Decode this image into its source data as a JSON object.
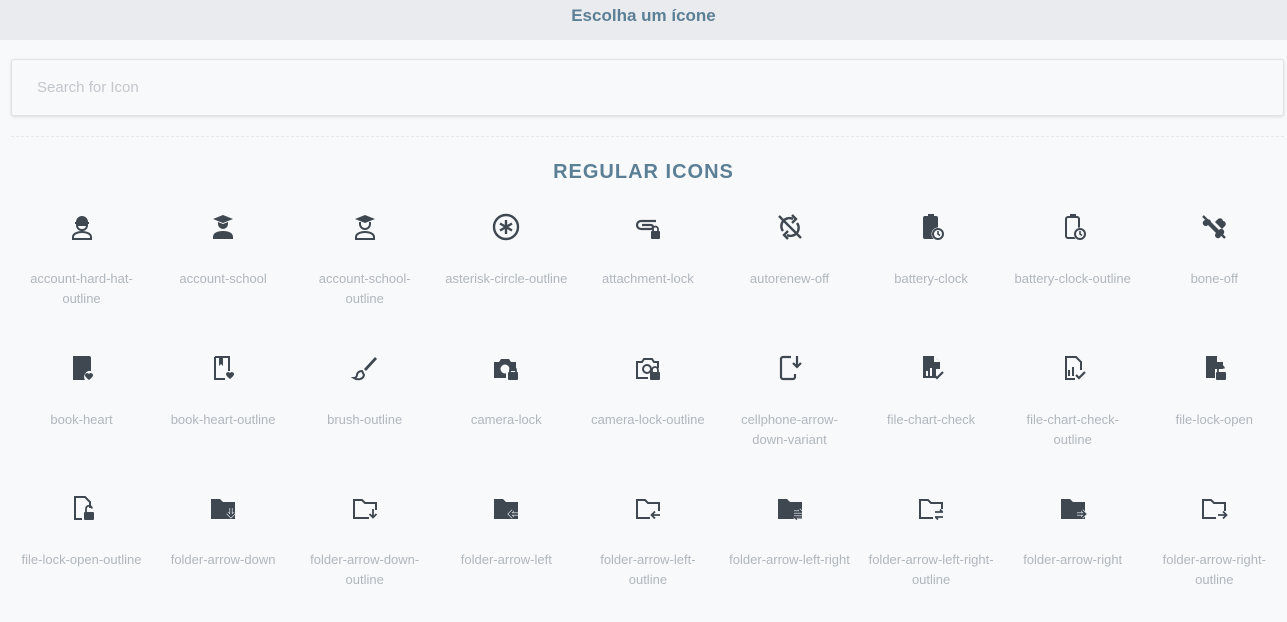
{
  "header": {
    "title": "Escolha um ícone"
  },
  "search": {
    "placeholder": "Search for Icon",
    "value": ""
  },
  "section": {
    "title": "REGULAR ICONS"
  },
  "icons": [
    {
      "name": "account-hard-hat-outline",
      "label": "account-hard-hat-outline"
    },
    {
      "name": "account-school",
      "label": "account-school"
    },
    {
      "name": "account-school-outline",
      "label": "account-school-outline"
    },
    {
      "name": "asterisk-circle-outline",
      "label": "asterisk-circle-outline"
    },
    {
      "name": "attachment-lock",
      "label": "attachment-lock"
    },
    {
      "name": "autorenew-off",
      "label": "autorenew-off"
    },
    {
      "name": "battery-clock",
      "label": "battery-clock"
    },
    {
      "name": "battery-clock-outline",
      "label": "battery-clock-outline"
    },
    {
      "name": "bone-off",
      "label": "bone-off"
    },
    {
      "name": "book-heart",
      "label": "book-heart"
    },
    {
      "name": "book-heart-outline",
      "label": "book-heart-outline"
    },
    {
      "name": "brush-outline",
      "label": "brush-outline"
    },
    {
      "name": "camera-lock",
      "label": "camera-lock"
    },
    {
      "name": "camera-lock-outline",
      "label": "camera-lock-outline"
    },
    {
      "name": "cellphone-arrow-down-variant",
      "label": "cellphone-arrow-down-variant"
    },
    {
      "name": "file-chart-check",
      "label": "file-chart-check"
    },
    {
      "name": "file-chart-check-outline",
      "label": "file-chart-check-outline"
    },
    {
      "name": "file-lock-open",
      "label": "file-lock-open"
    },
    {
      "name": "file-lock-open-outline",
      "label": "file-lock-open-outline"
    },
    {
      "name": "folder-arrow-down",
      "label": "folder-arrow-down"
    },
    {
      "name": "folder-arrow-down-outline",
      "label": "folder-arrow-down-outline"
    },
    {
      "name": "folder-arrow-left",
      "label": "folder-arrow-left"
    },
    {
      "name": "folder-arrow-left-outline",
      "label": "folder-arrow-left-outline"
    },
    {
      "name": "folder-arrow-left-right",
      "label": "folder-arrow-left-right"
    },
    {
      "name": "folder-arrow-left-right-outline",
      "label": "folder-arrow-left-right-outline"
    },
    {
      "name": "folder-arrow-right",
      "label": "folder-arrow-right"
    },
    {
      "name": "folder-arrow-right-outline",
      "label": "folder-arrow-right-outline"
    }
  ],
  "colors": {
    "accent": "#5b7f95",
    "icon": "#3f4851",
    "label": "#b0b7bd",
    "header_bg": "#e9ebee",
    "page_bg": "#f8f9fb"
  }
}
